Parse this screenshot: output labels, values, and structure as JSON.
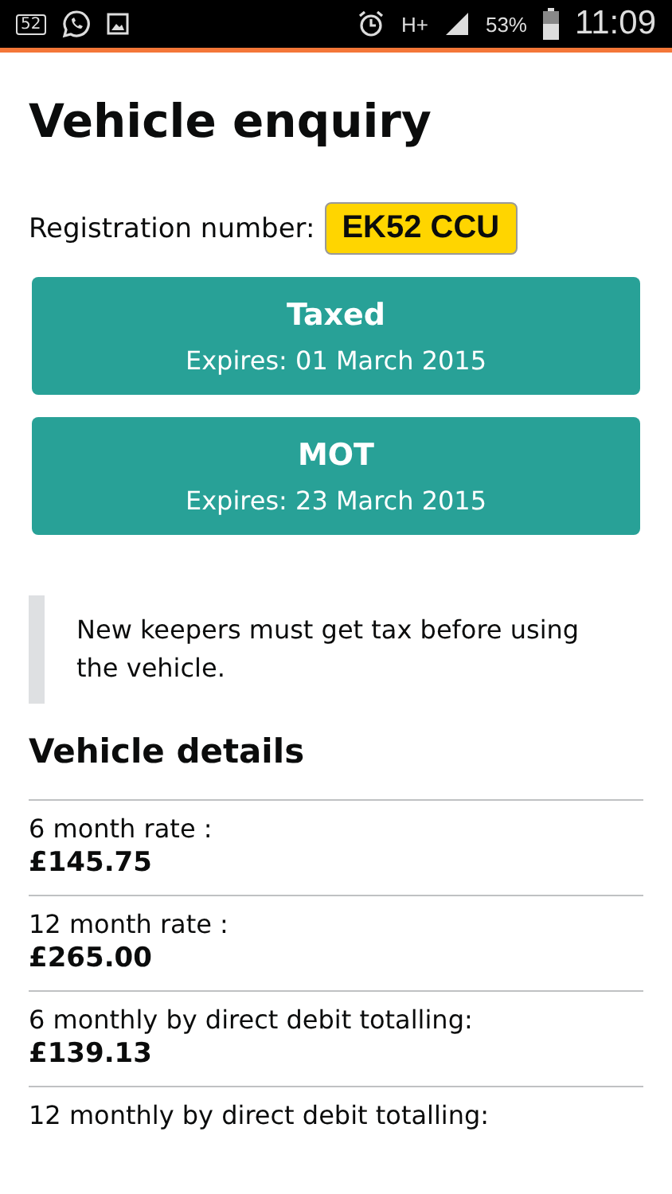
{
  "status_bar": {
    "notification_count": "52",
    "network": "H+",
    "battery": "53%",
    "time": "11:09"
  },
  "title": "Vehicle enquiry",
  "registration": {
    "label": "Registration number:",
    "plate": "EK52 CCU"
  },
  "status_cards": [
    {
      "title": "Taxed",
      "detail": "Expires: 01 March 2015"
    },
    {
      "title": "MOT",
      "detail": "Expires: 23 March 2015"
    }
  ],
  "notice": "New keepers must get tax before using the vehicle.",
  "details": {
    "heading": "Vehicle details",
    "rows": [
      {
        "label": "6 month rate :",
        "value": "£145.75"
      },
      {
        "label": "12 month rate :",
        "value": "£265.00"
      },
      {
        "label": "6 monthly by direct debit totalling:",
        "value": "£139.13"
      },
      {
        "label": "12 monthly by direct debit totalling:"
      }
    ]
  }
}
